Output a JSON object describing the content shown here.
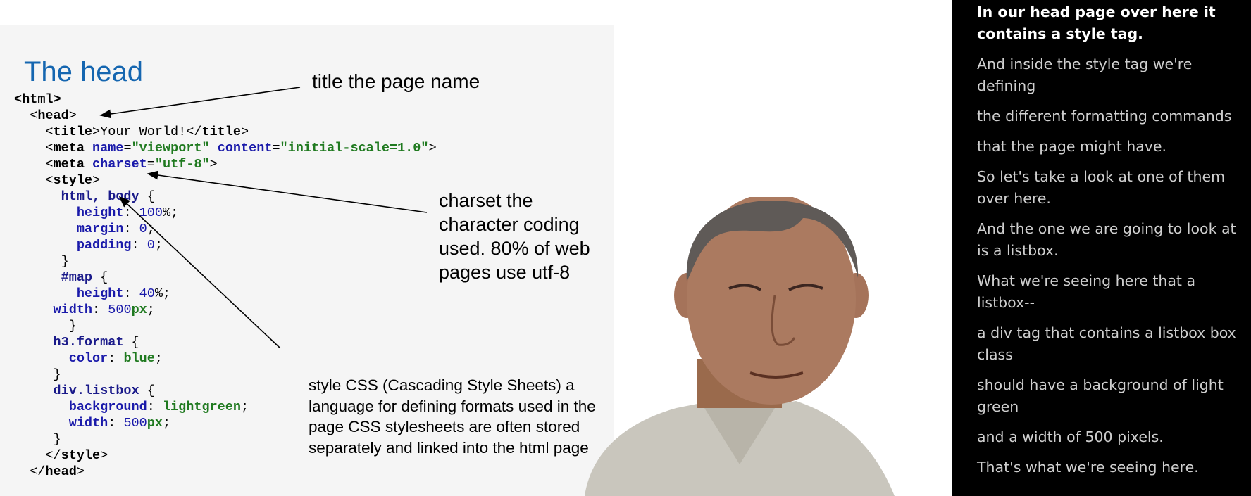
{
  "slide": {
    "title": "The head",
    "code_lines": [
      [
        {
          "t": "<",
          "c": "kw"
        },
        {
          "t": "html",
          "c": "kw"
        },
        {
          "t": ">",
          "c": "kw"
        }
      ],
      [
        {
          "t": "  <",
          "c": ""
        },
        {
          "t": "head",
          "c": "kw"
        },
        {
          "t": ">",
          "c": ""
        }
      ],
      [
        {
          "t": "    <",
          "c": ""
        },
        {
          "t": "title",
          "c": "kw"
        },
        {
          "t": ">Your World!</",
          "c": ""
        },
        {
          "t": "title",
          "c": "kw"
        },
        {
          "t": ">",
          "c": ""
        }
      ],
      [
        {
          "t": "    <",
          "c": ""
        },
        {
          "t": "meta",
          "c": "kw"
        },
        {
          "t": " ",
          "c": ""
        },
        {
          "t": "name",
          "c": "attr"
        },
        {
          "t": "=",
          "c": ""
        },
        {
          "t": "\"viewport\"",
          "c": "val"
        },
        {
          "t": " ",
          "c": ""
        },
        {
          "t": "content",
          "c": "attr"
        },
        {
          "t": "=",
          "c": ""
        },
        {
          "t": "\"initial-scale=1.0\"",
          "c": "val"
        },
        {
          "t": ">",
          "c": ""
        }
      ],
      [
        {
          "t": "    <",
          "c": ""
        },
        {
          "t": "meta",
          "c": "kw"
        },
        {
          "t": " ",
          "c": ""
        },
        {
          "t": "charset",
          "c": "attr"
        },
        {
          "t": "=",
          "c": ""
        },
        {
          "t": "\"utf-8\"",
          "c": "val"
        },
        {
          "t": ">",
          "c": ""
        }
      ],
      [
        {
          "t": "    <",
          "c": ""
        },
        {
          "t": "style",
          "c": "kw"
        },
        {
          "t": ">",
          "c": ""
        }
      ],
      [
        {
          "t": "      html, body",
          "c": "tag"
        },
        {
          "t": " {",
          "c": ""
        }
      ],
      [
        {
          "t": "        height",
          "c": "attr"
        },
        {
          "t": ": ",
          "c": ""
        },
        {
          "t": "100",
          "c": "num"
        },
        {
          "t": "%;",
          "c": ""
        }
      ],
      [
        {
          "t": "        margin",
          "c": "attr"
        },
        {
          "t": ": ",
          "c": ""
        },
        {
          "t": "0",
          "c": "num"
        },
        {
          "t": ";",
          "c": ""
        }
      ],
      [
        {
          "t": "        padding",
          "c": "attr"
        },
        {
          "t": ": ",
          "c": ""
        },
        {
          "t": "0",
          "c": "num"
        },
        {
          "t": ";",
          "c": ""
        }
      ],
      [
        {
          "t": "      }",
          "c": ""
        }
      ],
      [
        {
          "t": "      #map",
          "c": "tag"
        },
        {
          "t": " {",
          "c": ""
        }
      ],
      [
        {
          "t": "        height",
          "c": "attr"
        },
        {
          "t": ": ",
          "c": ""
        },
        {
          "t": "40",
          "c": "num"
        },
        {
          "t": "%;",
          "c": ""
        }
      ],
      [
        {
          "t": "     width",
          "c": "attr"
        },
        {
          "t": ": ",
          "c": ""
        },
        {
          "t": "500",
          "c": "num"
        },
        {
          "t": "px",
          "c": "val"
        },
        {
          "t": ";",
          "c": ""
        }
      ],
      [
        {
          "t": "       }",
          "c": ""
        }
      ],
      [
        {
          "t": "     h3.format",
          "c": "tag"
        },
        {
          "t": " {",
          "c": ""
        }
      ],
      [
        {
          "t": "       color",
          "c": "attr"
        },
        {
          "t": ": ",
          "c": ""
        },
        {
          "t": "blue",
          "c": "val"
        },
        {
          "t": ";",
          "c": ""
        }
      ],
      [
        {
          "t": "     }",
          "c": ""
        }
      ],
      [
        {
          "t": "     div.listbox",
          "c": "tag"
        },
        {
          "t": " {",
          "c": ""
        }
      ],
      [
        {
          "t": "       background",
          "c": "attr"
        },
        {
          "t": ": ",
          "c": ""
        },
        {
          "t": "lightgreen",
          "c": "val"
        },
        {
          "t": ";",
          "c": ""
        }
      ],
      [
        {
          "t": "       width",
          "c": "attr"
        },
        {
          "t": ": ",
          "c": ""
        },
        {
          "t": "500",
          "c": "num"
        },
        {
          "t": "px",
          "c": "val"
        },
        {
          "t": ";",
          "c": ""
        }
      ],
      [
        {
          "t": "     }",
          "c": ""
        }
      ],
      [
        {
          "t": "    </",
          "c": ""
        },
        {
          "t": "style",
          "c": "kw"
        },
        {
          "t": ">",
          "c": ""
        }
      ],
      [
        {
          "t": "  </",
          "c": ""
        },
        {
          "t": "head",
          "c": "kw"
        },
        {
          "t": ">",
          "c": ""
        }
      ]
    ],
    "annotations": {
      "title_note": "title the page name",
      "charset_note": "charset the character coding used. 80% of web pages use utf-8",
      "style_note": "style CSS (Cascading Style Sheets) a language for defining formats used in the page CSS stylesheets are often stored separately and linked into the html page"
    }
  },
  "captions": {
    "active": "In our head page over here it contains a style tag.",
    "lines": [
      "And inside the style tag we're defining",
      "the different formatting commands",
      "that the page might have.",
      "So let's take a look at one of them over here.",
      "And the one we are going to look at is a listbox.",
      "What we're seeing here that a listbox--",
      "a div tag that contains a listbox box class",
      "should have a background of light green",
      "and a width of 500 pixels.",
      "That's what we're seeing here."
    ]
  },
  "colors": {
    "slide_title": "#1566b0",
    "caption_bg": "#000000",
    "caption_text": "#cfcfcf",
    "caption_active": "#ffffff",
    "code_keyword_value": "#207a20",
    "code_attr": "#1a1aaa"
  },
  "icons": {
    "presenter": "presenter-video-figure"
  }
}
